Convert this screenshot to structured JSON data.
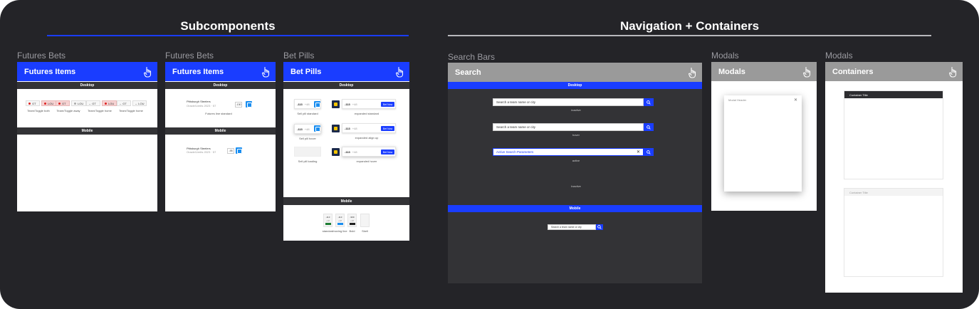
{
  "sections": {
    "left_title": "Subcomponents",
    "right_title": "Navigation + Containers",
    "left_rule_color": "#1a3dff",
    "right_rule_color": "#b8b8bc"
  },
  "frames": {
    "futures1": {
      "label": "Futures Bets",
      "header": "Futures Items",
      "desktop_bar": "Desktop",
      "mobile_bar": "Mobile",
      "pills": [
        {
          "group": [
            {
              "t": "GT",
              "sel": false
            },
            {
              "t": "LOU",
              "sel": true
            }
          ],
          "caption": "Team/Toggle both"
        },
        {
          "group": [
            {
              "t": "GT",
              "sel": true
            },
            {
              "t": "LOU",
              "sel": false
            }
          ],
          "caption": "Team/Toggle away"
        },
        {
          "group": [
            {
              "t": "GT",
              "sel": false
            },
            {
              "t": "LOU",
              "sel": true
            }
          ],
          "caption": "Team/Toggle home"
        },
        {
          "group": [
            {
              "t": "GT",
              "sel": false
            },
            {
              "t": "LOU",
              "sel": false
            }
          ],
          "caption": "Team/Toggle home"
        }
      ]
    },
    "futures2": {
      "label": "Futures Bets",
      "header": "Futures Items",
      "desktop_bar": "Desktop",
      "mobile_bar": "Mobile",
      "team": "Pittsburgh Steelers",
      "sub": "Oracle/Limits 2023 · 57",
      "odds": "-130",
      "caption": "Futures line standard",
      "mobile_team": "Pittsburgh Steelers",
      "mobile_sub": "Oracle/Limits 2023 · 57",
      "mobile_odds": "-95"
    },
    "betpills": {
      "label": "Bet Pills",
      "header": "Bet Pills",
      "desktop_bar": "Desktop",
      "mobile_bar": "Mobile",
      "rows": [
        {
          "left_odds": "-113",
          "left_sub": "+48",
          "left_caption": "Sell pill standard",
          "right_odds": "-113",
          "right_sub": "+48",
          "right_btn": "Bet Now",
          "right_caption": "expanded standard"
        },
        {
          "left_odds": "-113",
          "left_sub": "+48",
          "left_caption": "Sell pill hover",
          "right_odds": "-113",
          "right_sub": "+48",
          "right_btn": "Bet Now",
          "right_caption": "expanded align up"
        },
        {
          "left_odds": "",
          "left_sub": "",
          "left_caption": "Sell pill loading",
          "right_odds": "-113",
          "right_sub": "+48",
          "right_btn": "Bet Now",
          "right_caption": "expanded hover"
        }
      ],
      "mobile_tiles": [
        {
          "top": "-113",
          "mid": "+48",
          "swatch": "#1e7e34",
          "caption": "standard"
        },
        {
          "top": "-113",
          "mid": "+48",
          "swatch": "#1a8ef0",
          "caption": "moving line"
        },
        {
          "top": "-999",
          "mid": "+48",
          "swatch": "#222222",
          "caption": "Bold"
        },
        {
          "top": "",
          "mid": "",
          "swatch": "#f4f4f4",
          "caption": "Skell"
        }
      ]
    },
    "search": {
      "label": "Search Bars",
      "header": "Search",
      "desktop_bar": "Desktop",
      "mobile_bar": "Mobile",
      "placeholder": "Search a team name or city",
      "active_value": "Active Search Parameters",
      "captions": [
        "inactive",
        "hover",
        "active",
        "Inactive"
      ],
      "mobile_placeholder": "Search a team name or city"
    },
    "modals": {
      "label": "Modals",
      "header": "Modals",
      "modal_title": "Modal Header"
    },
    "containers": {
      "label": "Modals",
      "header": "Containers",
      "title1": "Container Title",
      "title2": "Container Title"
    }
  },
  "colors": {
    "blue_header": "#1a3dff",
    "gray_header": "#9a9a9a",
    "dark_bar": "#333336"
  }
}
